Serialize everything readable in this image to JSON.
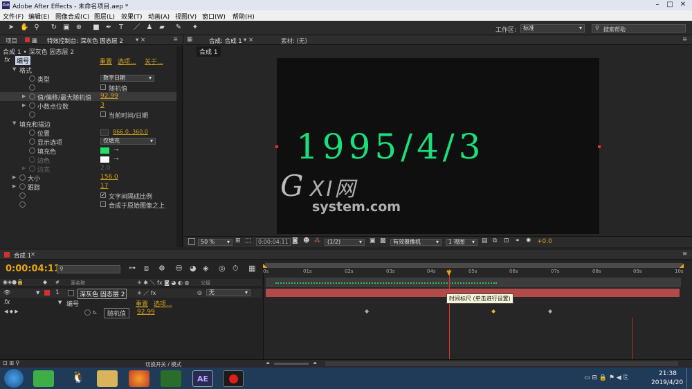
{
  "window": {
    "title": "Adobe After Effects - 未命名项目.aep *"
  },
  "menu": [
    "文件(F)",
    "编辑(E)",
    "图像合成(C)",
    "图层(L)",
    "效果(T)",
    "动画(A)",
    "视图(V)",
    "窗口(W)",
    "帮助(H)"
  ],
  "toolbar": {
    "workspace_label": "工作区:",
    "workspace_value": "标准",
    "search_placeholder": "搜索帮助"
  },
  "left_panel": {
    "tab_project": "项目",
    "tab_effects": "特效控制台: 深灰色 固态层 2",
    "breadcrumb": "合成 1 • 深灰色 固态层 2",
    "effect": {
      "prefix": "fx",
      "name": "编号",
      "reset": "重置",
      "options": "选项...",
      "about": "关于..."
    },
    "rows": {
      "format": "格式",
      "type_label": "类型",
      "type_value": "数字日期",
      "random_label": "随机值",
      "value_label": "值/偏移/最大随机值",
      "value": "92.99",
      "decimals_label": "小数点位数",
      "decimals": "3",
      "current_time_label": "当前时间/日期",
      "fill_stroke": "填充和描边",
      "position_label": "位置",
      "position_value": "866.0, 360.0",
      "display_label": "显示选项",
      "display_value": "仅填充",
      "fill_label": "填充色",
      "stroke_label": "边色",
      "stroke_width_label": "边宽",
      "stroke_width": "2.0",
      "size_label": "大小",
      "size": "156.0",
      "tracking_label": "跟踪",
      "tracking": "17",
      "proportional_label": "文字间隔成比例",
      "composite_label": "合成于原始图像之上"
    }
  },
  "comp_panel": {
    "tab": "合成: 合成 1",
    "material": "素材: (无)",
    "subtab": "合成 1",
    "display_text": "1995/4/3",
    "watermark": {
      "big": "G",
      "mid": "XI网",
      "small": "system.com"
    },
    "footer": {
      "zoom": "50 %",
      "time": "0:00:04:11",
      "res": "(1/2)",
      "camera": "有效摄像机",
      "views": "1 视图",
      "exposure": "+0.0"
    }
  },
  "timeline": {
    "tab": "合成 1",
    "current_time": "0:00:04:11",
    "search_placeholder": "",
    "col_source": "源名称",
    "col_parent": "父级",
    "layer_num": "1",
    "layer_name": "深灰色 固态层 2",
    "parent_value": "无",
    "effect_name": "编号",
    "reset": "重置",
    "options": "选项...",
    "prop_name": "随机值",
    "prop_value": "92.99",
    "ruler": [
      "0s",
      "01s",
      "02s",
      "03s",
      "04s",
      "05s",
      "06s",
      "07s",
      "08s",
      "09s",
      "10s"
    ],
    "tooltip": "时间标尺 (单击进行设置)",
    "footer": "切换开关 / 模式"
  },
  "taskbar": {
    "time": "21:38",
    "date": "2019/4/20",
    "ae_label": "AE"
  },
  "colors": {
    "accent": "#d6a51e",
    "layer_bar": "#b34a4a",
    "text_green": "#19e07a",
    "fill_swatch": "#22e06a"
  }
}
